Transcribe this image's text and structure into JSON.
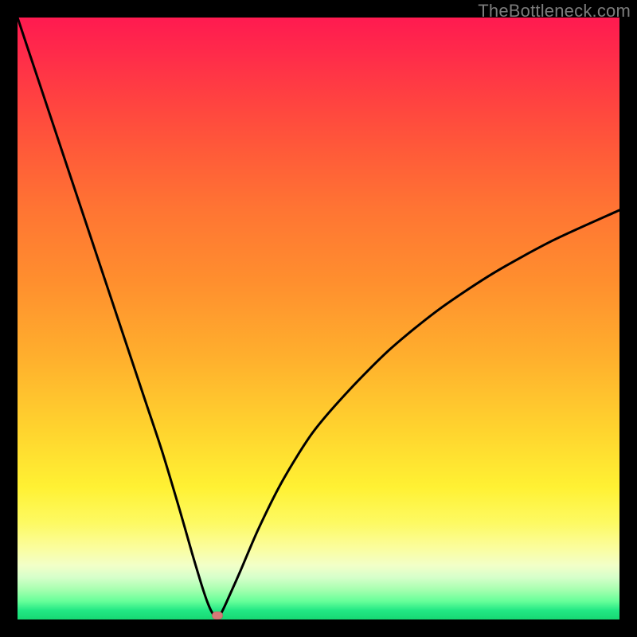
{
  "watermark": "TheBottleneck.com",
  "chart_data": {
    "type": "line",
    "title": "",
    "xlabel": "",
    "ylabel": "",
    "xlim": [
      0,
      100
    ],
    "ylim": [
      0,
      100
    ],
    "grid": false,
    "legend": false,
    "background_gradient": {
      "stops": [
        {
          "pos": 0,
          "color": "#ff1a50"
        },
        {
          "pos": 0.32,
          "color": "#ff7533"
        },
        {
          "pos": 0.68,
          "color": "#ffd22e"
        },
        {
          "pos": 0.88,
          "color": "#fbfd9c"
        },
        {
          "pos": 1.0,
          "color": "#17d873"
        }
      ]
    },
    "series": [
      {
        "name": "bottleneck-curve",
        "color": "#000000",
        "x": [
          0,
          3,
          6,
          9,
          12,
          15,
          18,
          21,
          24,
          27,
          29,
          30.5,
          31.5,
          32.3,
          33.0,
          33.8,
          35,
          37,
          40,
          44,
          49,
          55,
          62,
          70,
          79,
          89,
          100
        ],
        "y": [
          100,
          91,
          82,
          73,
          64,
          55,
          46,
          37,
          28,
          18,
          11,
          6.0,
          3.0,
          1.2,
          0.5,
          1.0,
          3.5,
          8,
          15,
          23,
          31,
          38,
          45,
          51.5,
          57.5,
          63,
          68
        ]
      }
    ],
    "marker": {
      "name": "optimal-point",
      "x": 33.2,
      "y": 0.6,
      "color": "#d67a78"
    }
  }
}
